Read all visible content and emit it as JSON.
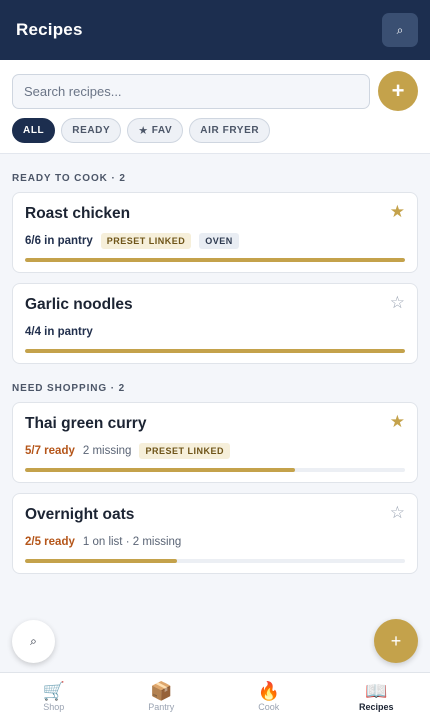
{
  "header": {
    "title": "Recipes",
    "search_icon": "⌕"
  },
  "search": {
    "placeholder": "Search recipes..."
  },
  "add_button": "+",
  "filters": [
    {
      "label": "ALL",
      "active": true
    },
    {
      "label": "READY",
      "active": false
    },
    {
      "label": "FAV",
      "icon": "★",
      "active": false
    },
    {
      "label": "AIR FRYER",
      "active": false
    }
  ],
  "sections": [
    {
      "label": "READY TO COOK · 2",
      "recipes": [
        {
          "name": "Roast chicken",
          "favorite": true,
          "status": "6/6 in pantry",
          "status_type": "ok",
          "note": "",
          "tags": [
            "PRESET LINKED",
            "OVEN"
          ],
          "progress": 1.0
        },
        {
          "name": "Garlic noodles",
          "favorite": false,
          "status": "4/4 in pantry",
          "status_type": "ok",
          "note": "",
          "tags": [],
          "progress": 1.0
        }
      ]
    },
    {
      "label": "NEED SHOPPING · 2",
      "recipes": [
        {
          "name": "Thai green curry",
          "favorite": true,
          "status": "5/7 ready",
          "status_type": "warn",
          "note": "2 missing",
          "tags": [
            "PRESET LINKED"
          ],
          "progress": 0.71
        },
        {
          "name": "Overnight oats",
          "favorite": false,
          "status": "2/5 ready",
          "status_type": "warn",
          "note": "1 on list · 2 missing",
          "tags": [],
          "progress": 0.4
        }
      ]
    }
  ],
  "fab_left_icon": "⌕",
  "fab_right_icon": "+",
  "tabs": [
    {
      "label": "Shop",
      "icon": "🛒",
      "active": false
    },
    {
      "label": "Pantry",
      "icon": "📦",
      "active": false
    },
    {
      "label": "Cook",
      "icon": "🔥",
      "active": false
    },
    {
      "label": "Recipes",
      "icon": "📖",
      "active": true
    }
  ],
  "colors": {
    "navy": "#1c2e4f",
    "gold": "#c4a24b",
    "warn": "#b5561a"
  }
}
